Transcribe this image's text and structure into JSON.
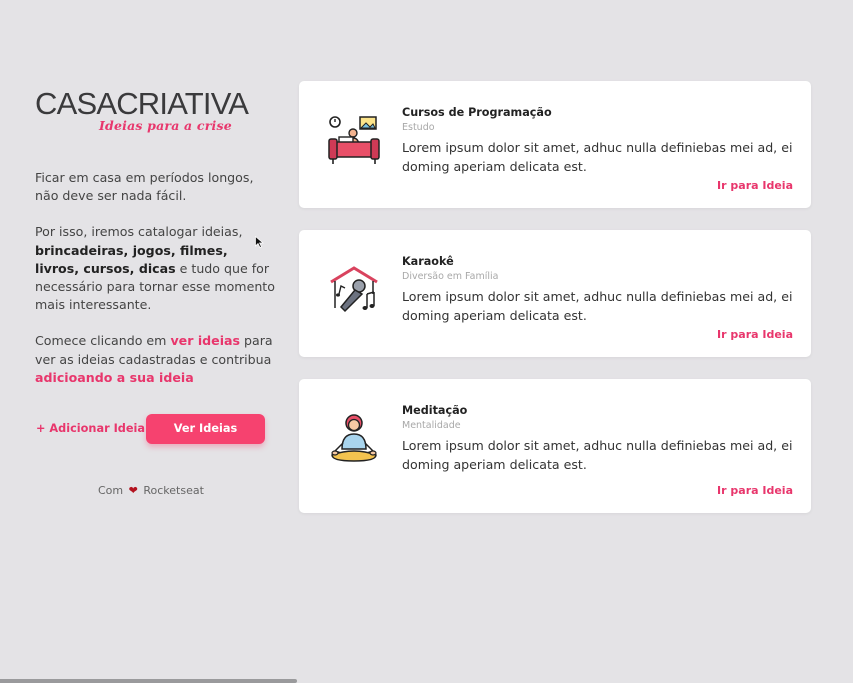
{
  "logo": {
    "main_bold": "CASA",
    "main_thin": "CRIATIVA",
    "tagline": "Ideias para a crise"
  },
  "intro": {
    "p1": "Ficar em casa em períodos longos, não deve ser nada fácil.",
    "p2_before": "Por isso, iremos catalogar ideias,",
    "p2_strong": "brincadeiras, jogos, filmes, livros, cursos, dicas",
    "p2_after": " e tudo que for necessário para tornar esse momento mais interessante.",
    "p3_a": "Comece clicando em ",
    "p3_link1": "ver ideias",
    "p3_b": " para ver as  ideias cadastradas e contribua ",
    "p3_link2": "adicioando a sua ideia"
  },
  "actions": {
    "add_label": "+ Adicionar Ideia",
    "view_label": "Ver Ideias"
  },
  "footer": {
    "prefix": "Com",
    "suffix": "Rocketseat"
  },
  "colors": {
    "accent": "#e8366c",
    "button": "#f6426f",
    "background": "#e4e3e6"
  },
  "cards": [
    {
      "title": "Cursos de Programação",
      "category": "Estudo",
      "description": "Lorem ipsum dolor sit amet, adhuc nulla definiebas mei ad, ei doming aperiam delicata est.",
      "link": "Ir para Ideia",
      "icon": "programming-course-icon"
    },
    {
      "title": "Karaokê",
      "category": "Diversão em Família",
      "description": "Lorem ipsum dolor sit amet, adhuc nulla definiebas mei ad, ei doming aperiam delicata est.",
      "link": "Ir para Ideia",
      "icon": "karaoke-icon"
    },
    {
      "title": "Meditação",
      "category": "Mentalidade",
      "description": "Lorem ipsum dolor sit amet, adhuc nulla definiebas mei ad, ei doming aperiam delicata est.",
      "link": "Ir para Ideia",
      "icon": "meditation-icon"
    }
  ]
}
